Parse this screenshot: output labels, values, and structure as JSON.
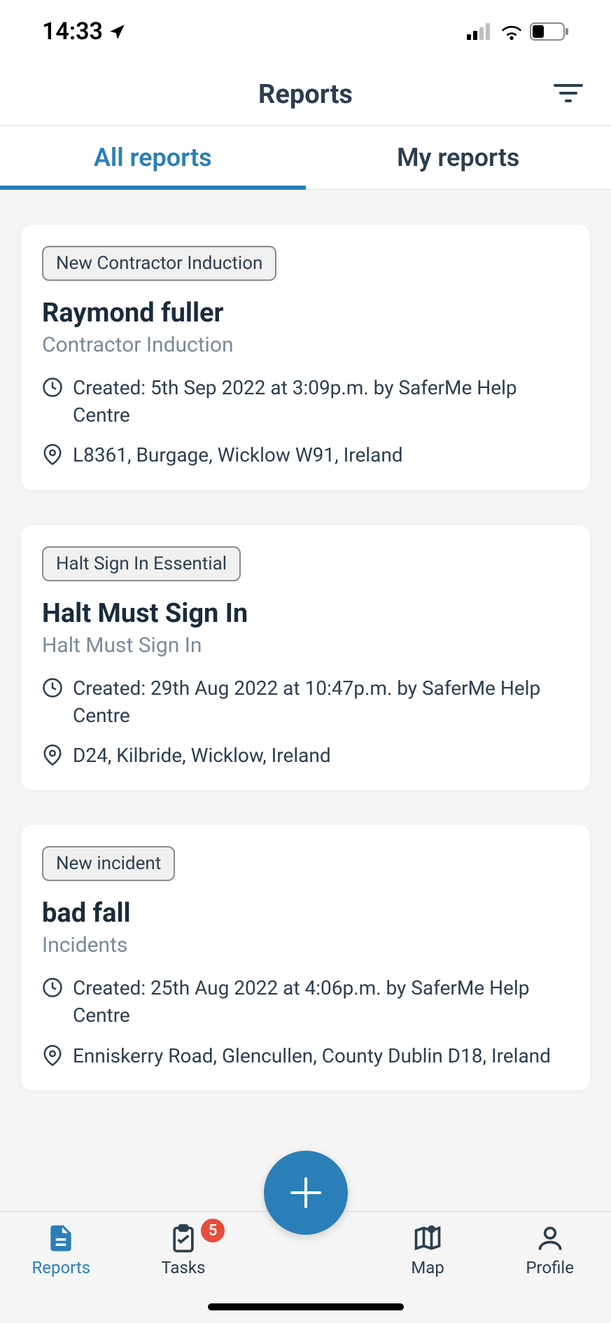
{
  "status_bar": {
    "time": "14:33"
  },
  "header": {
    "title": "Reports"
  },
  "tabs": [
    {
      "label": "All reports",
      "active": true
    },
    {
      "label": "My reports",
      "active": false
    }
  ],
  "reports": [
    {
      "badge": "New Contractor Induction",
      "title": "Raymond fuller",
      "subtitle": "Contractor Induction",
      "created": "Created: 5th Sep 2022 at 3:09p.m. by SaferMe Help Centre",
      "location": "L8361, Burgage, Wicklow W91, Ireland"
    },
    {
      "badge": "Halt Sign In Essential",
      "title": "Halt Must Sign In",
      "subtitle": "Halt Must Sign In",
      "created": "Created: 29th Aug 2022 at 10:47p.m. by SaferMe Help Centre",
      "location": "D24, Kilbride, Wicklow, Ireland"
    },
    {
      "badge": "New incident",
      "title": "bad fall",
      "subtitle": "Incidents",
      "created": "Created: 25th Aug 2022 at 4:06p.m. by SaferMe Help Centre",
      "location": "Enniskerry Road, Glencullen, County Dublin D18, Ireland"
    }
  ],
  "bottom_nav": {
    "reports": "Reports",
    "tasks": "Tasks",
    "tasks_badge": "5",
    "map": "Map",
    "profile": "Profile"
  }
}
